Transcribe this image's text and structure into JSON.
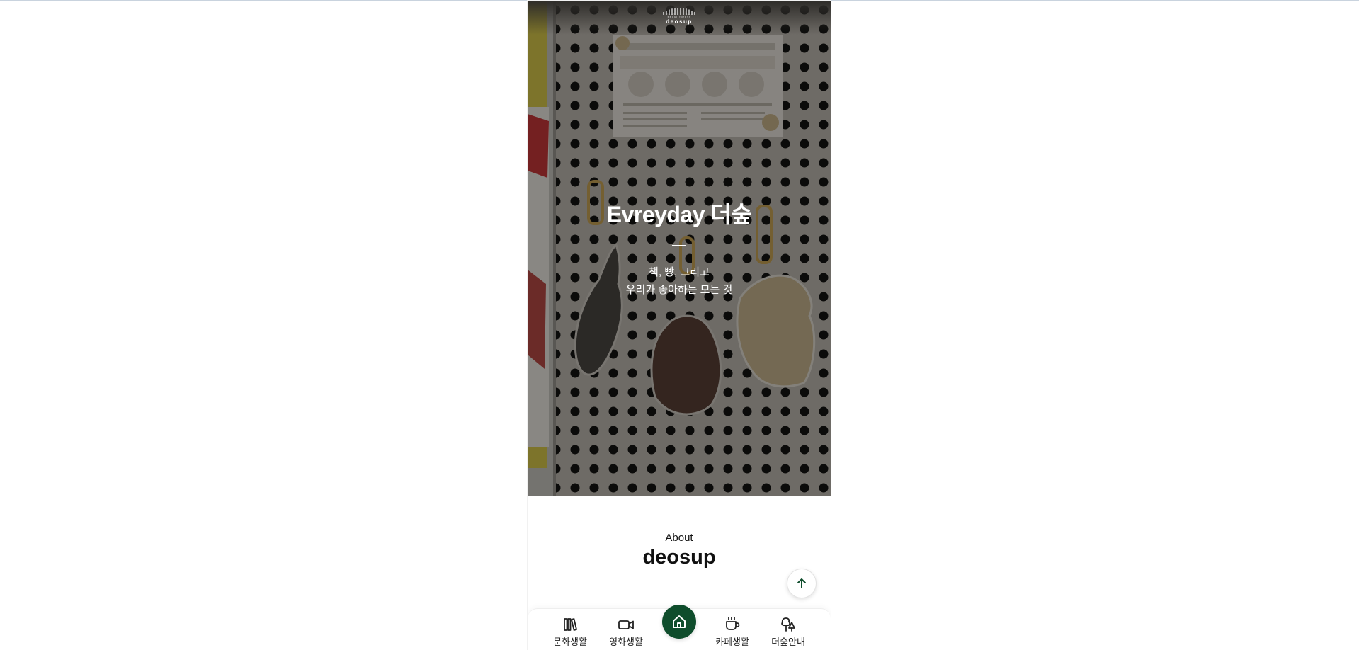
{
  "logo": {
    "sub": "seoul forest",
    "word": "deosup"
  },
  "hero": {
    "title": "Evreyday 더숲",
    "divider": "—",
    "subtitle_line1": "책, 빵, 그리고",
    "subtitle_line2": "우리가 좋아하는 모든 것"
  },
  "about": {
    "label": "About",
    "title": "deosup"
  },
  "scroll_top": {
    "icon": "arrow-up-icon"
  },
  "nav": {
    "items": [
      {
        "label": "문화생활",
        "icon": "books-icon"
      },
      {
        "label": "영화생활",
        "icon": "video-camera-icon"
      },
      {
        "label": "",
        "icon": "home-icon"
      },
      {
        "label": "카페생활",
        "icon": "coffee-cup-icon"
      },
      {
        "label": "더숲안내",
        "icon": "trees-icon"
      }
    ]
  },
  "colors": {
    "accent": "#0f4d2c",
    "text": "#111111",
    "background": "#ffffff"
  }
}
